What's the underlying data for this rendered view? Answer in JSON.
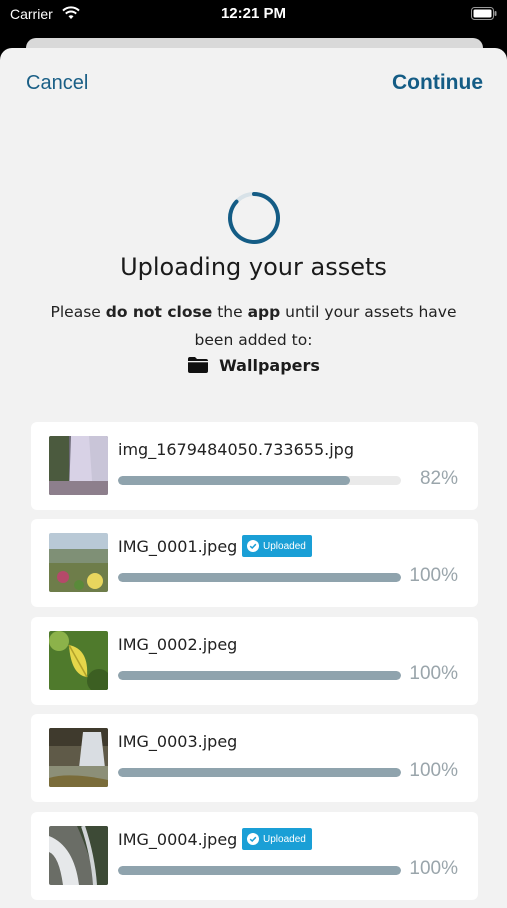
{
  "status_bar": {
    "carrier": "Carrier",
    "time": "12:21 PM"
  },
  "nav": {
    "cancel": "Cancel",
    "continue": "Continue"
  },
  "title": "Uploading your assets",
  "message": {
    "part1": "Please ",
    "bold1": "do not close",
    "part2": " the ",
    "bold2": "app",
    "part3": " until your assets have been added to:"
  },
  "folder": {
    "name": "Wallpapers",
    "icon": "folder-icon"
  },
  "colors": {
    "accent": "#145c85",
    "badge": "#1a9fd6",
    "progress_fill": "#8fa3ad"
  },
  "uploads": [
    {
      "file": "img_1679484050.733655.jpg",
      "percent_label": "82%",
      "progress": 0.82,
      "badge": ""
    },
    {
      "file": "IMG_0001.jpeg",
      "percent_label": "100%",
      "progress": 1.0,
      "badge": "Uploaded"
    },
    {
      "file": "IMG_0002.jpeg",
      "percent_label": "100%",
      "progress": 1.0,
      "badge": ""
    },
    {
      "file": "IMG_0003.jpeg",
      "percent_label": "100%",
      "progress": 1.0,
      "badge": ""
    },
    {
      "file": "IMG_0004.jpeg",
      "percent_label": "100%",
      "progress": 1.0,
      "badge": "Uploaded"
    }
  ]
}
